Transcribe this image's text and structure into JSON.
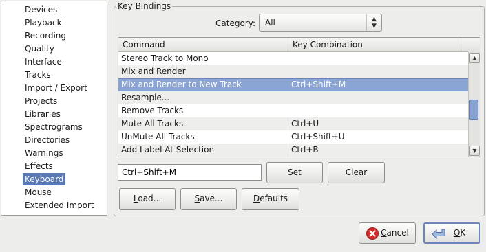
{
  "sidebar": {
    "items": [
      {
        "label": "Devices",
        "selected": false
      },
      {
        "label": "Playback",
        "selected": false
      },
      {
        "label": "Recording",
        "selected": false
      },
      {
        "label": "Quality",
        "selected": false
      },
      {
        "label": "Interface",
        "selected": false
      },
      {
        "label": "Tracks",
        "selected": false
      },
      {
        "label": "Import / Export",
        "selected": false
      },
      {
        "label": "Projects",
        "selected": false
      },
      {
        "label": "Libraries",
        "selected": false
      },
      {
        "label": "Spectrograms",
        "selected": false
      },
      {
        "label": "Directories",
        "selected": false
      },
      {
        "label": "Warnings",
        "selected": false
      },
      {
        "label": "Effects",
        "selected": false
      },
      {
        "label": "Keyboard",
        "selected": true
      },
      {
        "label": "Mouse",
        "selected": false
      },
      {
        "label": "Extended Import",
        "selected": false
      }
    ]
  },
  "key_bindings": {
    "title": "Key Bindings",
    "category_label": "Category:",
    "category_value": "All",
    "columns": {
      "command": "Command",
      "key": "Key Combination"
    },
    "rows": [
      {
        "command": "Stereo Track to Mono",
        "key": "",
        "selected": false
      },
      {
        "command": "Mix and Render",
        "key": "",
        "selected": false
      },
      {
        "command": "Mix and Render to New Track",
        "key": "Ctrl+Shift+M",
        "selected": true
      },
      {
        "command": "Resample...",
        "key": "",
        "selected": false
      },
      {
        "command": "Remove Tracks",
        "key": "",
        "selected": false
      },
      {
        "command": "Mute All Tracks",
        "key": "Ctrl+U",
        "selected": false
      },
      {
        "command": "UnMute All Tracks",
        "key": "Ctrl+Shift+U",
        "selected": false
      },
      {
        "command": "Add Label At Selection",
        "key": "Ctrl+B",
        "selected": false
      }
    ],
    "key_field_value": "Ctrl+Shift+M",
    "set_label": "Set",
    "clear_pre": "Cl",
    "clear_u": "e",
    "clear_post": "ar",
    "load_u": "L",
    "load_post": "oad...",
    "save_u": "S",
    "save_post": "ave...",
    "defaults_u": "D",
    "defaults_post": "efaults"
  },
  "dialog": {
    "cancel_u": "C",
    "cancel_post": "ancel",
    "ok_u": "O",
    "ok_post": "K"
  },
  "colors": {
    "selection": "#5879b5",
    "row_selection": "#8aa4d4",
    "cancel_icon": "#d42a2a",
    "ok_icon": "#6a8fc8"
  },
  "icons": {
    "cancel": "cancel-icon",
    "ok": "ok-arrow-icon",
    "combo_arrows": "up-down-arrows-icon"
  }
}
